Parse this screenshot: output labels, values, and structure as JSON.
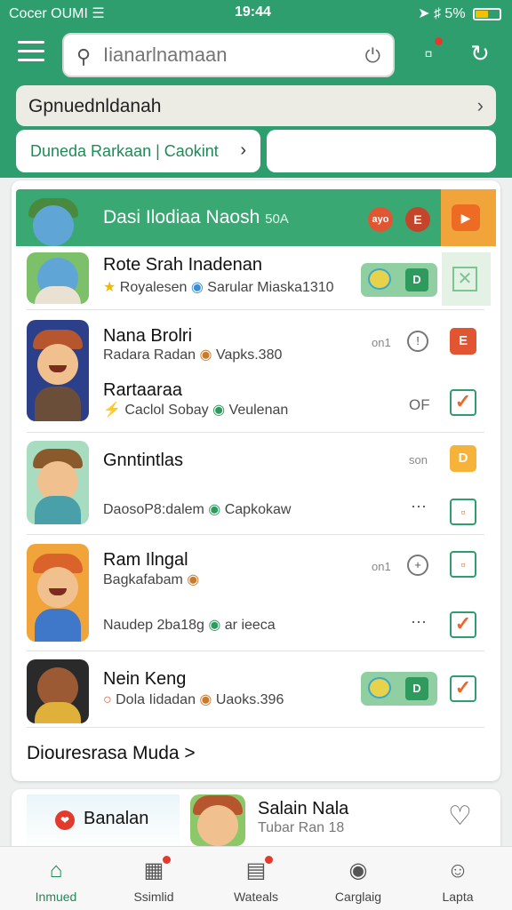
{
  "status": {
    "carrier": "Cocer OUMI",
    "time": "19:44",
    "battery": "5%"
  },
  "search": {
    "placeholder": "Iianarlnamaan"
  },
  "location_bar": {
    "label": "Gpnuednldanah"
  },
  "chips": [
    {
      "label": "Duneda Rarkaan | Caokint"
    },
    {
      "label": ""
    }
  ],
  "featured": {
    "title": "Dasi Ilodiaa Naosh",
    "count": "50A",
    "badge_a": "ayo",
    "badge_b": "E"
  },
  "rows": [
    {
      "title": "Rote Srah Inadenan",
      "sub_a": "Royalesen",
      "sub_b": "Sarular Miaska1310"
    },
    {
      "title": "Nana Brolri",
      "sub": "Radara Radan",
      "sub_b": "Vapks.380",
      "meta": "on1",
      "action": "E"
    },
    {
      "title": "Rartaaraa",
      "sub": "Caclol Sobay",
      "sub_b": "Veulenan",
      "meta": "OF"
    },
    {
      "title": "Gnntintlas",
      "meta": "son",
      "action": "D",
      "sub": "DaosoP8:dalem",
      "sub_b": "Capkokaw"
    },
    {
      "title": "Ram Ilngal",
      "sub": "Bagkafabam",
      "meta": "on1",
      "sub2": "Naudep 2ba18g",
      "sub2_b": "ar ieeca"
    },
    {
      "title": "Nein Keng",
      "sub": "Dola Iidadan",
      "sub_b": "Uaoks.396"
    }
  ],
  "see_more": "Diouresrasa Muda >",
  "promo": {
    "label": "Banalan",
    "title": "Salain Nala",
    "sub": "Tubar Ran 18"
  },
  "nav": [
    {
      "label": "Inmued",
      "icon": "home-icon"
    },
    {
      "label": "Ssimlid",
      "icon": "grid-icon"
    },
    {
      "label": "Wateals",
      "icon": "list-icon"
    },
    {
      "label": "Carglaig",
      "icon": "globe-icon"
    },
    {
      "label": "Lapta",
      "icon": "person-icon"
    }
  ],
  "colors": {
    "brand": "#2f9e6e",
    "accent": "#f0a43a",
    "alert": "#e25533"
  }
}
